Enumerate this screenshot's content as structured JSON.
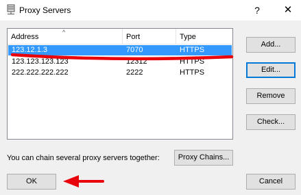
{
  "window": {
    "title": "Proxy Servers",
    "help_glyph": "?",
    "close_glyph": "✕"
  },
  "list": {
    "columns": [
      {
        "label": "Address"
      },
      {
        "label": "Port"
      },
      {
        "label": "Type"
      }
    ],
    "sort_glyph": "^",
    "rows": [
      {
        "address": "123.12.1.3",
        "port": "7070",
        "type": "HTTPS",
        "selected": true
      },
      {
        "address": "123.123.123.123",
        "port": "12312",
        "type": "HTTPS",
        "selected": false
      },
      {
        "address": "222.222.222.222",
        "port": "2222",
        "type": "HTTPS",
        "selected": false
      }
    ]
  },
  "side_buttons": {
    "add": "Add...",
    "edit": "Edit...",
    "remove": "Remove",
    "check": "Check..."
  },
  "chain": {
    "label": "You can chain several proxy servers together:",
    "button": "Proxy Chains..."
  },
  "footer": {
    "ok": "OK",
    "cancel": "Cancel"
  },
  "colors": {
    "selection": "#3399ff",
    "annotation": "#e8000b",
    "focus": "#0078d7"
  }
}
